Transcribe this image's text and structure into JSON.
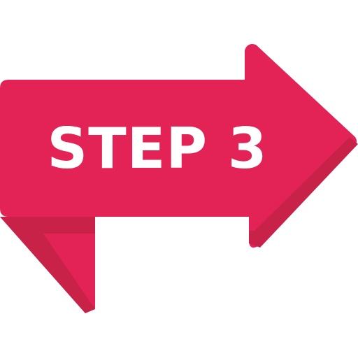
{
  "graphic": {
    "label": "STEP 3",
    "icon": "right-arrow-icon",
    "colors": {
      "arrow_main": "#e32356",
      "arrow_shade": "#c82249",
      "text": "#ffffff",
      "background": "#ffffff"
    }
  }
}
